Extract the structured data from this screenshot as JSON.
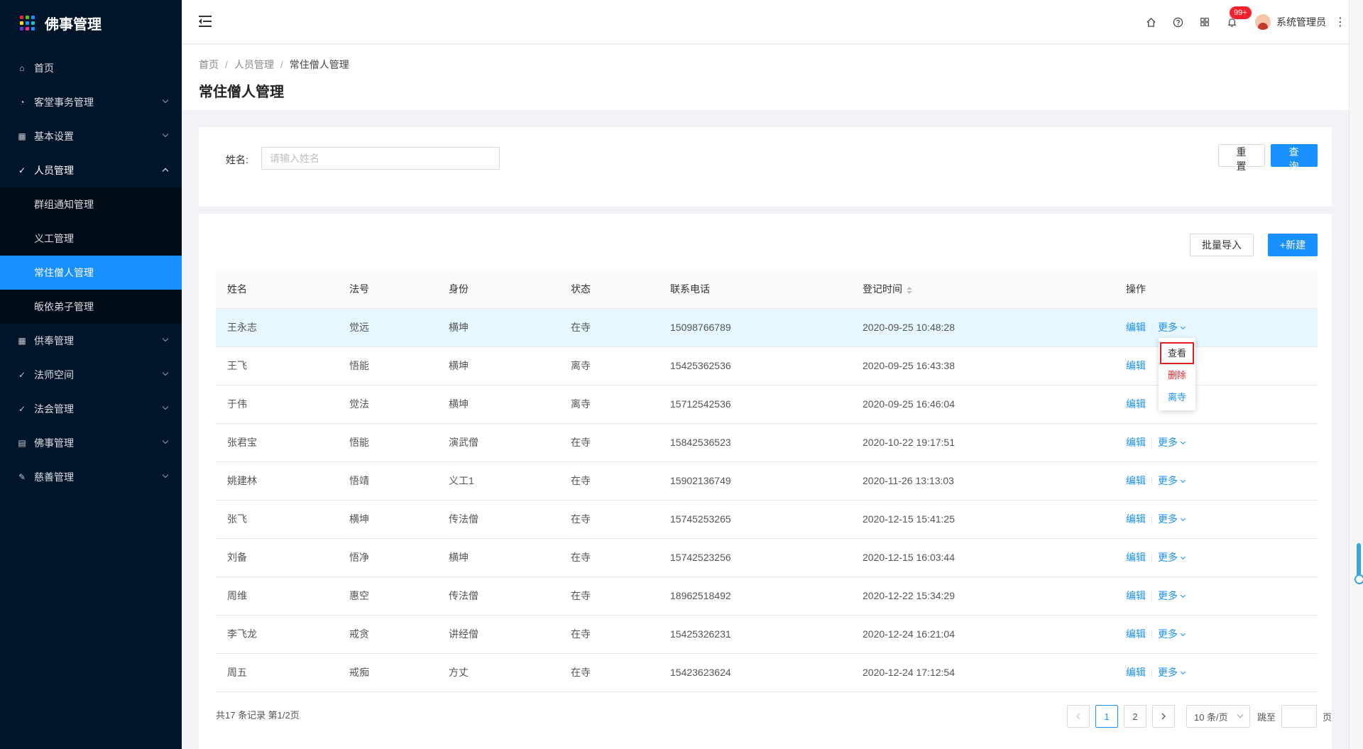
{
  "app": {
    "title": "佛事管理",
    "logo_colors": [
      "#f5222d",
      "#52c41a",
      "#1890ff",
      "#fadb14",
      "#1890ff",
      "#13c2c2",
      "#722ed1",
      "#eb2f96",
      "#1890ff"
    ]
  },
  "sidebar": {
    "items": [
      {
        "label": "首页",
        "icon": "home-icon",
        "glyph": "⌂"
      },
      {
        "label": "客堂事务管理",
        "icon": "dashboard-icon",
        "glyph": "◔"
      },
      {
        "label": "基本设置",
        "icon": "table-icon",
        "glyph": "▦"
      },
      {
        "label": "人员管理",
        "icon": "check-circle-icon",
        "glyph": "✓"
      },
      {
        "label": "供奉管理",
        "icon": "table-icon",
        "glyph": "▦"
      },
      {
        "label": "法师空间",
        "icon": "check-circle-icon",
        "glyph": "✓"
      },
      {
        "label": "法会管理",
        "icon": "check-circle-icon",
        "glyph": "✓"
      },
      {
        "label": "佛事管理",
        "icon": "profile-icon",
        "glyph": "▤"
      },
      {
        "label": "慈善管理",
        "icon": "form-icon",
        "glyph": "✎"
      }
    ],
    "submenu": [
      "群组通知管理",
      "义工管理",
      "常住僧人管理",
      "皈依弟子管理"
    ]
  },
  "header": {
    "badge": "99+",
    "user": "系统管理员",
    "icons": [
      "home-icon",
      "question-icon",
      "appstore-icon",
      "bell-icon"
    ]
  },
  "page": {
    "breadcrumb": [
      "首页",
      "人员管理",
      "常住僧人管理"
    ],
    "title": "常住僧人管理"
  },
  "search": {
    "label": "姓名:",
    "placeholder": "请输入姓名",
    "reset": "重 置",
    "query": "查 询"
  },
  "toolbar": {
    "import": "批量导入",
    "create": "+新建"
  },
  "table": {
    "columns": [
      "姓名",
      "法号",
      "身份",
      "状态",
      "联系电话",
      "登记时间",
      "操作"
    ],
    "edit_label": "编辑",
    "more_label": "更多",
    "rows": [
      [
        "王永志",
        "觉远",
        "横坤",
        "在寺",
        "15098766789",
        "2020-09-25 10:48:28"
      ],
      [
        "王飞",
        "悟能",
        "横坤",
        "离寺",
        "15425362536",
        "2020-09-25 16:43:38"
      ],
      [
        "于伟",
        "觉法",
        "横坤",
        "离寺",
        "15712542536",
        "2020-09-25 16:46:04"
      ],
      [
        "张君宝",
        "悟能",
        "演武僧",
        "在寺",
        "15842536523",
        "2020-10-22 19:17:51"
      ],
      [
        "姚建林",
        "悟靖",
        "义工1",
        "在寺",
        "15902136749",
        "2020-11-26 13:13:03"
      ],
      [
        "张飞",
        "横坤",
        "传法僧",
        "在寺",
        "15745253265",
        "2020-12-15 15:41:25"
      ],
      [
        "刘备",
        "悟净",
        "横坤",
        "在寺",
        "15742523256",
        "2020-12-15 16:03:44"
      ],
      [
        "周维",
        "惠空",
        "传法僧",
        "在寺",
        "18962518492",
        "2020-12-22 15:34:29"
      ],
      [
        "李飞龙",
        "戒贪",
        "讲经僧",
        "在寺",
        "15425326231",
        "2020-12-24 16:21:04"
      ],
      [
        "周五",
        "戒痴",
        "方丈",
        "在寺",
        "15423623624",
        "2020-12-24 17:12:54"
      ]
    ]
  },
  "dropdown": {
    "view": "查看",
    "delete": "删除",
    "leave": "离寺"
  },
  "pagination": {
    "total": "共17 条记录 第1/2页",
    "pages": [
      "1",
      "2"
    ],
    "current": "1",
    "page_size": "10 条/页",
    "jump_label": "跳至",
    "page_label": "页"
  }
}
